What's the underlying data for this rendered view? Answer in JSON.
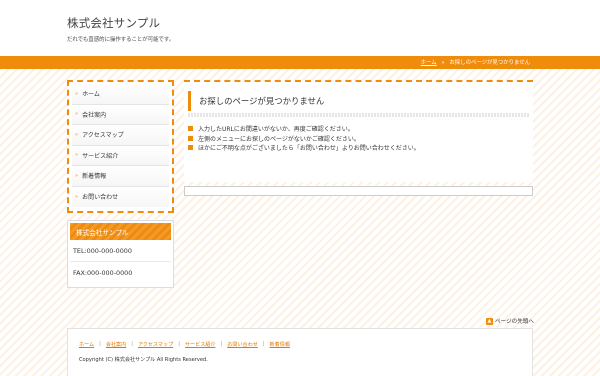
{
  "header": {
    "site_title": "株式会社サンプル",
    "site_description": "だれでも直感的に操作することが可能です。"
  },
  "breadcrumb": {
    "home": "ホーム",
    "separator": "»",
    "current": "お探しのページが見つかりません"
  },
  "sidebar": {
    "items": [
      {
        "label": "ホーム"
      },
      {
        "label": "会社案内"
      },
      {
        "label": "アクセスマップ"
      },
      {
        "label": "サービス紹介"
      },
      {
        "label": "新着情報"
      },
      {
        "label": "お問い合わせ"
      }
    ]
  },
  "company": {
    "name": "株式会社サンプル",
    "tel": "TEL:000-000-0000",
    "fax": "FAX:000-000-0000"
  },
  "main": {
    "heading": "お探しのページが見つかりません",
    "messages": [
      "入力したURLにお間違いがないか、再度ご確認ください。",
      "左側のメニューにお探しのページがないかご確認ください。",
      "ほかにご不明な点がございましたら「お問い合わせ」よりお問い合わせください。"
    ]
  },
  "pagetop": {
    "label": "ページの先頭へ"
  },
  "footer": {
    "links": [
      "ホーム",
      "会社案内",
      "アクセスマップ",
      "サービス紹介",
      "お問い合わせ",
      "新着情報"
    ],
    "separator": "|",
    "copyright": "Copyright (C) 株式会社サンプル All Rights Reserved."
  },
  "colors": {
    "accent": "#f08c0c",
    "link": "#e07a00",
    "stripe": "#fdf1e4"
  }
}
